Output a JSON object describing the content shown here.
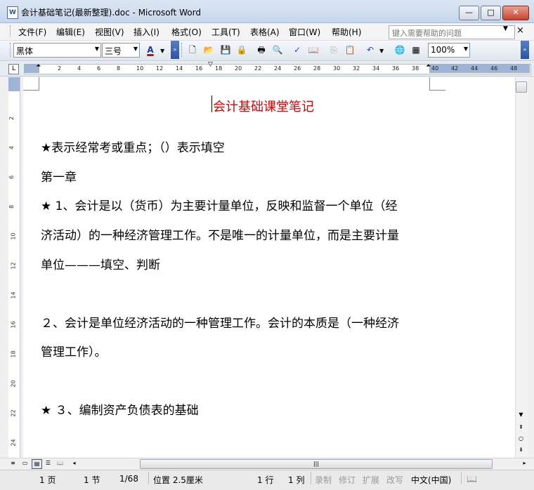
{
  "window": {
    "title": "会计基础笔记(最新整理).doc - Microsoft Word",
    "doc_icon": "W",
    "minimize": "—",
    "maximize": "□",
    "close": "✕"
  },
  "menu": {
    "items": [
      "文件(F)",
      "编辑(E)",
      "视图(V)",
      "插入(I)",
      "格式(O)",
      "工具(T)",
      "表格(A)",
      "窗口(W)",
      "帮助(H)"
    ],
    "help_placeholder": "键入需要帮助的问题",
    "doc_close": "×"
  },
  "toolbar": {
    "font_name": "黑体",
    "font_size": "三号",
    "font_color_label": "A",
    "zoom": "100%"
  },
  "ruler": {
    "ticks": [
      "2",
      "4",
      "6",
      "8",
      "10",
      "12",
      "14",
      "16",
      "18",
      "20",
      "22",
      "24",
      "26",
      "28",
      "30",
      "32",
      "34",
      "36",
      "38",
      "40",
      "42",
      "44",
      "46",
      "48"
    ],
    "vticks": [
      "2",
      "4",
      "6",
      "8",
      "10",
      "12",
      "14",
      "16",
      "18",
      "20",
      "22",
      "24"
    ]
  },
  "document": {
    "title": "会计基础课堂笔记",
    "lines": [
      "★表示经常考或重点；（）表示填空",
      "第一章",
      "★ 1、会计是以（货币）为主要计量单位，反映和监督一个单位（经",
      "济活动）的一种经济管理工作。不是唯一的计量单位，而是主要计量",
      "单位———填空、判断",
      "２、会计是单位经济活动的一种管理工作。会计的本质是（一种经济",
      "管理工作）。",
      "★ ３、编制资产负债表的基础"
    ]
  },
  "statusbar": {
    "page": "1 页",
    "section": "1 节",
    "page_of": "1/68",
    "position": "位置 2.5厘米",
    "line": "1 行",
    "column": "1 列",
    "rec": "录制",
    "trk": "修订",
    "ext": "扩展",
    "ovr": "改写",
    "language": "中文(中国)"
  }
}
